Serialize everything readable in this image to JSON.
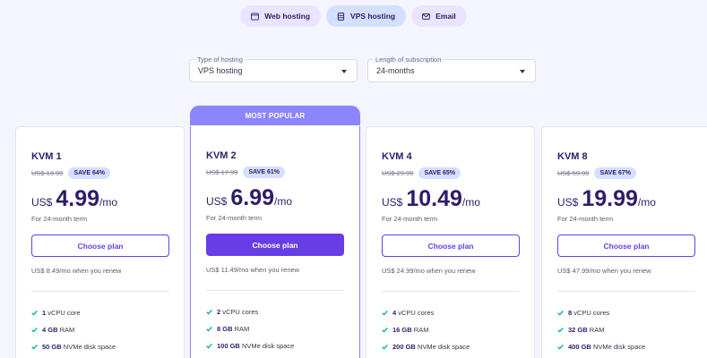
{
  "tabs": [
    {
      "label": "Web hosting",
      "icon": "browser-icon"
    },
    {
      "label": "VPS hosting",
      "icon": "server-icon"
    },
    {
      "label": "Email",
      "icon": "mail-icon"
    }
  ],
  "filters": {
    "type": {
      "label": "Type of hosting",
      "value": "VPS hosting"
    },
    "length": {
      "label": "Length of subscription",
      "value": "24-months"
    }
  },
  "popular_label": "MOST POPULAR",
  "colors": {
    "accent": "#673de6",
    "popular": "#8c85ff",
    "check": "#00b090",
    "badge": "#d5dfff"
  },
  "plans": [
    {
      "name": "KVM 1",
      "old": "US$ 13.99",
      "save": "SAVE 64%",
      "currency": "US$",
      "price": "4.99",
      "per": "/mo",
      "term": "For 24-month term",
      "button": "Choose plan",
      "renew": "US$ 8.49/mo when you renew",
      "features": [
        {
          "bold": "1",
          "text": " vCPU core"
        },
        {
          "bold": "4 GB",
          "text": " RAM"
        },
        {
          "bold": "50 GB",
          "text": " NVMe disk space"
        }
      ]
    },
    {
      "name": "KVM 2",
      "old": "US$ 17.99",
      "save": "SAVE 61%",
      "currency": "US$",
      "price": "6.99",
      "per": "/mo",
      "term": "For 24-month term",
      "button": "Choose plan",
      "renew": "US$ 11.49/mo when you renew",
      "features": [
        {
          "bold": "2",
          "text": " vCPU cores"
        },
        {
          "bold": "8 GB",
          "text": " RAM"
        },
        {
          "bold": "100 GB",
          "text": " NVMe disk space"
        }
      ]
    },
    {
      "name": "KVM 4",
      "old": "US$ 29.99",
      "save": "SAVE 65%",
      "currency": "US$",
      "price": "10.49",
      "per": "/mo",
      "term": "For 24-month term",
      "button": "Choose plan",
      "renew": "US$ 24.99/mo when you renew",
      "features": [
        {
          "bold": "4",
          "text": " vCPU cores"
        },
        {
          "bold": "16 GB",
          "text": " RAM"
        },
        {
          "bold": "200 GB",
          "text": " NVMe disk space"
        }
      ]
    },
    {
      "name": "KVM 8",
      "old": "US$ 59.99",
      "save": "SAVE 67%",
      "currency": "US$",
      "price": "19.99",
      "per": "/mo",
      "term": "For 24-month term",
      "button": "Choose plan",
      "renew": "US$ 47.99/mo when you renew",
      "features": [
        {
          "bold": "8",
          "text": " vCPU cores"
        },
        {
          "bold": "32 GB",
          "text": " RAM"
        },
        {
          "bold": "400 GB",
          "text": " NVMe disk space"
        }
      ]
    }
  ]
}
